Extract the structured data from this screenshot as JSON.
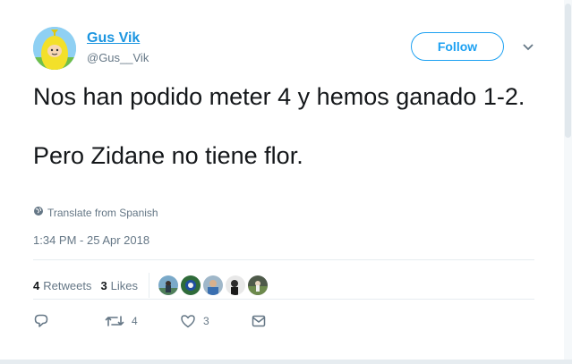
{
  "user": {
    "name": "Gus Vik",
    "handle": "@Gus__Vik"
  },
  "header": {
    "follow_label": "Follow"
  },
  "tweet": {
    "line1": "Nos han podido meter 4 y hemos ganado 1-2.",
    "line2": "Pero Zidane no tiene flor.",
    "translate_label": "Translate from Spanish",
    "timestamp": "1:34 PM - 25 Apr 2018"
  },
  "stats": {
    "retweets_count": "4",
    "retweets_label": "Retweets",
    "likes_count": "3",
    "likes_label": "Likes"
  },
  "actions": {
    "retweet_count": "4",
    "like_count": "3"
  },
  "colors": {
    "accent": "#1da1f2",
    "link": "#1b95e0",
    "muted": "#657786"
  },
  "icons": [
    "chevron-down-icon",
    "globe-icon",
    "reply-icon",
    "retweet-icon",
    "heart-icon",
    "message-icon"
  ]
}
